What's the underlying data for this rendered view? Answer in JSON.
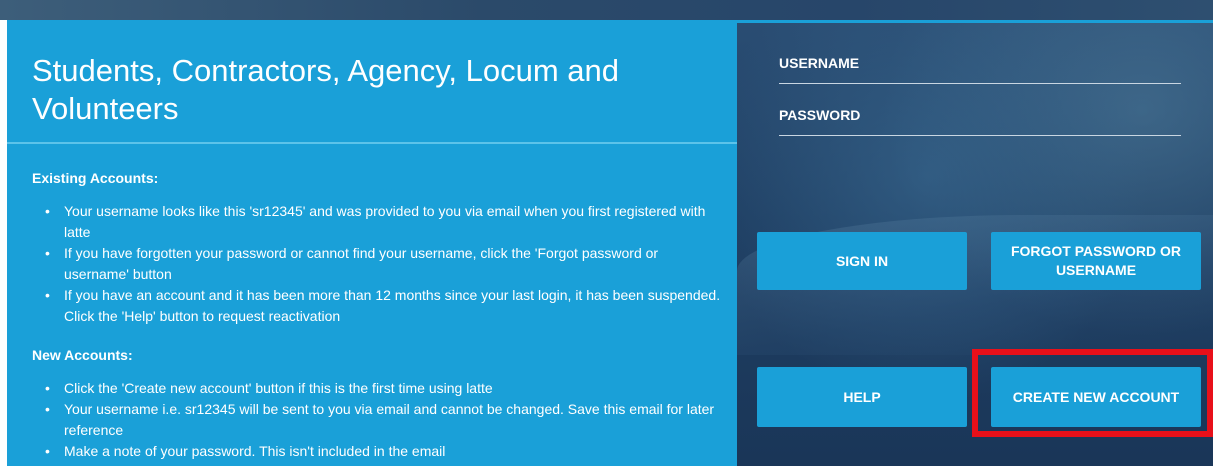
{
  "left_panel": {
    "title": "Students, Contractors, Agency, Locum and Volunteers",
    "existing_heading": "Existing Accounts:",
    "existing_items": [
      "Your username looks like this 'sr12345' and was provided to you via email when you first registered with latte",
      "If you have forgotten your password or cannot find your username, click the 'Forgot password or username' button",
      "If you have an account and it has been more than 12 months since your last login, it has been suspended. Click the 'Help' button to request reactivation"
    ],
    "new_heading": "New Accounts:",
    "new_items": [
      "Click the 'Create new account' button if this is the first time using latte",
      "Your username i.e. sr12345 will be sent to you via email and cannot be changed. Save this email for later reference",
      "Make a note of your password. This isn't included in the email"
    ]
  },
  "login_panel": {
    "username_label": "USERNAME",
    "password_label": "PASSWORD",
    "sign_in_label": "SIGN IN",
    "forgot_label": "FORGOT PASSWORD OR USERNAME",
    "help_label": "HELP",
    "create_label": "CREATE NEW ACCOUNT"
  },
  "colors": {
    "panel_blue": "#1aa0d8",
    "dark_navy": "#1f3f63",
    "highlight_red": "#e8101a"
  }
}
